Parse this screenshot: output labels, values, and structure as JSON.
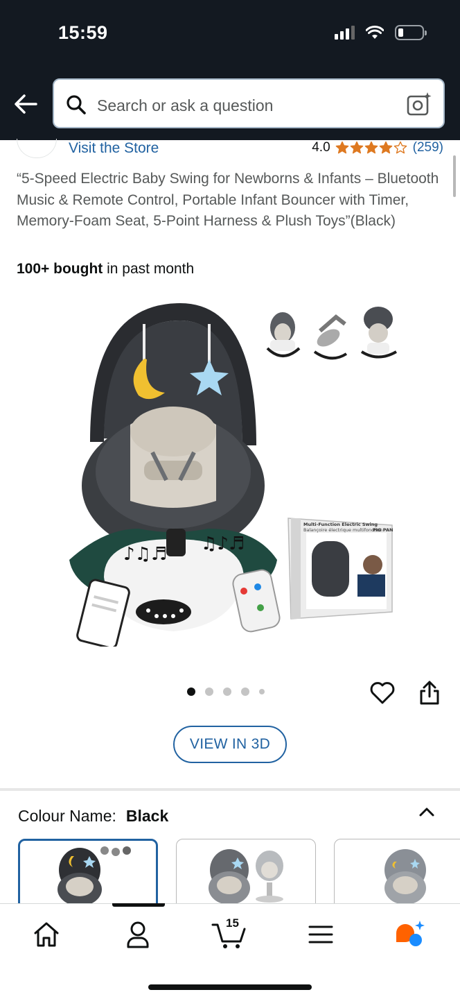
{
  "status_bar": {
    "time": "15:59"
  },
  "search": {
    "placeholder": "Search or ask a question"
  },
  "store": {
    "visit_label": "Visit the Store",
    "rating": "4.0",
    "rating_stars": 4,
    "rating_count": "(259)"
  },
  "product": {
    "title": "“5-Speed Electric Baby Swing for Newborns & Infants – Bluetooth Music & Remote Control, Portable Infant Bouncer with Timer, Memory-Foam Seat, 5-Point Harness & Plush Toys”(Black)",
    "bought_bold": "100+ bought",
    "bought_rest": " in past month",
    "image_description_icon": "baby-swing-image",
    "box_label_en": "Multi-Function Electric Swing",
    "box_label_fr": "Balançoire électrique multifonction",
    "brand_mark": "PIG PAN"
  },
  "carousel": {
    "image_count": 5,
    "active_index": 0
  },
  "actions": {
    "view_3d_label": "VIEW IN 3D"
  },
  "variants": {
    "colour_label": "Colour Name:",
    "colour_value": "Black",
    "options": [
      "Black",
      "Grey",
      "Light Grey"
    ],
    "selected_index": 0
  },
  "bottom_nav": {
    "items": [
      "home-icon",
      "account-icon",
      "cart-icon",
      "menu-icon",
      "rufus-icon"
    ],
    "cart_count": "15",
    "active_index": 1
  },
  "colors": {
    "header_bg": "#131921",
    "link_blue": "#2162a1",
    "star_orange": "#de7921",
    "rufus_orange": "#ff6200",
    "rufus_blue": "#1a8cff"
  }
}
